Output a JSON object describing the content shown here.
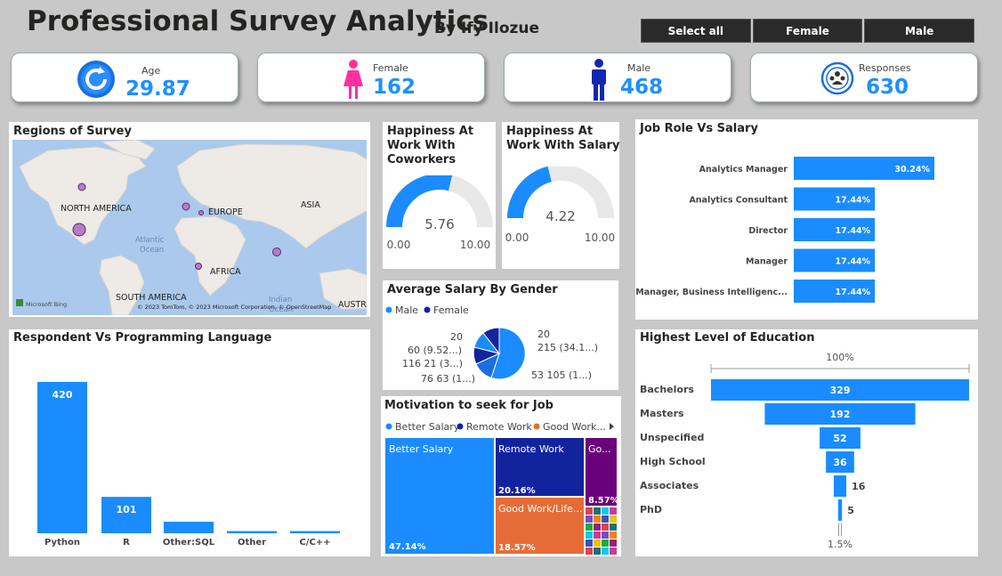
{
  "header": {
    "title": "Professional Survey Analytics",
    "author": "By Ify  Ilozue"
  },
  "slicer": {
    "options": [
      "Select all",
      "Female",
      "Male"
    ]
  },
  "kpis": [
    {
      "label": "Age",
      "value": "29.87",
      "icon": "refresh-icon"
    },
    {
      "label": "Female",
      "value": "162",
      "icon": "female-icon"
    },
    {
      "label": "Male",
      "value": "468",
      "icon": "male-icon"
    },
    {
      "label": "Responses",
      "value": "630",
      "icon": "group-icon"
    }
  ],
  "map": {
    "title": "Regions of Survey",
    "labels": {
      "na": "NORTH AMERICA",
      "eu": "EUROPE",
      "asia": "ASIA",
      "africa": "AFRICA",
      "sa": "SOUTH AMERICA",
      "austra": "AUSTRA",
      "atlantic": "Atlantic\nOcean",
      "indian": "Indian\nOcean"
    },
    "credits": "© 2023 TomTom, © 2023 Microsoft Corporation, © OpenStreetMap",
    "bing": "Microsoft Bing",
    "colors": {
      "water": "#aac9ec",
      "land": "#eeeae6",
      "bubble": "#b57cc8"
    }
  },
  "gauges": [
    {
      "title": "Happiness At Work With Coworkers",
      "value": 5.76,
      "value_label": "5.76",
      "min_label": "0.00",
      "max_label": "10.00",
      "min": 0,
      "max": 10
    },
    {
      "title": "Happiness At Work With Salary",
      "value": 4.22,
      "value_label": "4.22",
      "min_label": "0.00",
      "max_label": "10.00",
      "min": 0,
      "max": 10
    }
  ],
  "salary_gender": {
    "title": "Average Salary By Gender",
    "legend": [
      "Male",
      "Female"
    ],
    "legend_colors": [
      "#1a8cff",
      "#12239e"
    ],
    "labels": [
      "20",
      "60 (9.52...)",
      "116 21 (3...)",
      "76 63 (1...)",
      "20",
      "215 (34.1...)",
      "53 105 (1...)"
    ]
  },
  "motivation": {
    "title": "Motivation to seek for Job",
    "legend": [
      "Better Salary",
      "Remote Work",
      "Good Work..."
    ],
    "tiles": [
      {
        "name": "Better Salary",
        "pct": "47.14%",
        "color": "#1a8cff"
      },
      {
        "name": "Remote Work",
        "pct": "20.16%",
        "color": "#12239e"
      },
      {
        "name": "Good Work/Life...",
        "pct": "18.57%",
        "color": "#e66c37"
      },
      {
        "name": "Go...",
        "pct": "8.57%",
        "color": "#6b007b"
      }
    ]
  },
  "chart_data": [
    {
      "type": "bar",
      "title": "Job Role Vs Salary",
      "orientation": "horizontal",
      "categories": [
        "Analytics Manager",
        "Analytics Consultant",
        "Director",
        "Manager",
        "Manager, Business Intelligenc..."
      ],
      "values": [
        30.24,
        17.44,
        17.44,
        17.44,
        17.44
      ],
      "value_labels": [
        "30.24%",
        "17.44%",
        "17.44%",
        "17.44%",
        "17.44%"
      ],
      "color": "#1a8cff"
    },
    {
      "type": "bar",
      "title": "Respondent Vs Programming Language",
      "categories": [
        "Python",
        "R",
        "Other:SQL",
        "Other",
        "C/C++"
      ],
      "values": [
        420,
        101,
        32,
        6,
        6
      ],
      "value_labels": [
        "420",
        "101",
        "",
        "",
        ""
      ],
      "color": "#1a8cff"
    },
    {
      "type": "bar",
      "title": "Highest Level of Education",
      "orientation": "funnel",
      "top_label": "100%",
      "bottom_label": "1.5%",
      "categories": [
        "Bachelors",
        "Masters",
        "Unspecified",
        "High School",
        "Associates",
        "PhD"
      ],
      "values": [
        329,
        192,
        52,
        36,
        16,
        5
      ],
      "value_labels": [
        "329",
        "192",
        "52",
        "36",
        "16",
        "5"
      ],
      "color": "#1a8cff"
    }
  ]
}
